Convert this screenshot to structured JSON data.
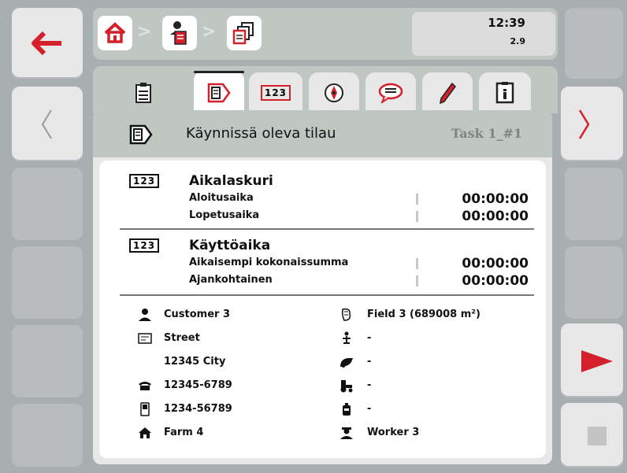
{
  "header": {
    "time": "12:39",
    "version": "2.9"
  },
  "breadcrumb": {
    "separator": ">"
  },
  "order": {
    "title": "Käynnissä oleva tilau",
    "task_id": "Task 1_#1"
  },
  "timer": {
    "title": "Aikalaskuri",
    "rows": [
      {
        "label": "Aloitusaika",
        "value": "00:00:00"
      },
      {
        "label": "Lopetusaika",
        "value": "00:00:00"
      }
    ]
  },
  "usage": {
    "title": "Käyttöaika",
    "rows": [
      {
        "label": "Aikaisempi kokonaissumma",
        "value": "00:00:00"
      },
      {
        "label": "Ajankohtainen",
        "value": "00:00:00"
      }
    ]
  },
  "details": {
    "customer": "Customer 3",
    "street": "Street",
    "city": "12345 City",
    "phone": "12345-6789",
    "mobile": "1234-56789",
    "farm": "Farm 4",
    "field": "Field 3 (689008 m²)",
    "machine": "-",
    "fertilizer": "-",
    "tractor": "-",
    "implement": "-",
    "worker": "Worker 3"
  },
  "icon_tags": {
    "counter": "123"
  },
  "colors": {
    "accent_red": "#d3202a",
    "panel_header": "#bfc7c3"
  }
}
